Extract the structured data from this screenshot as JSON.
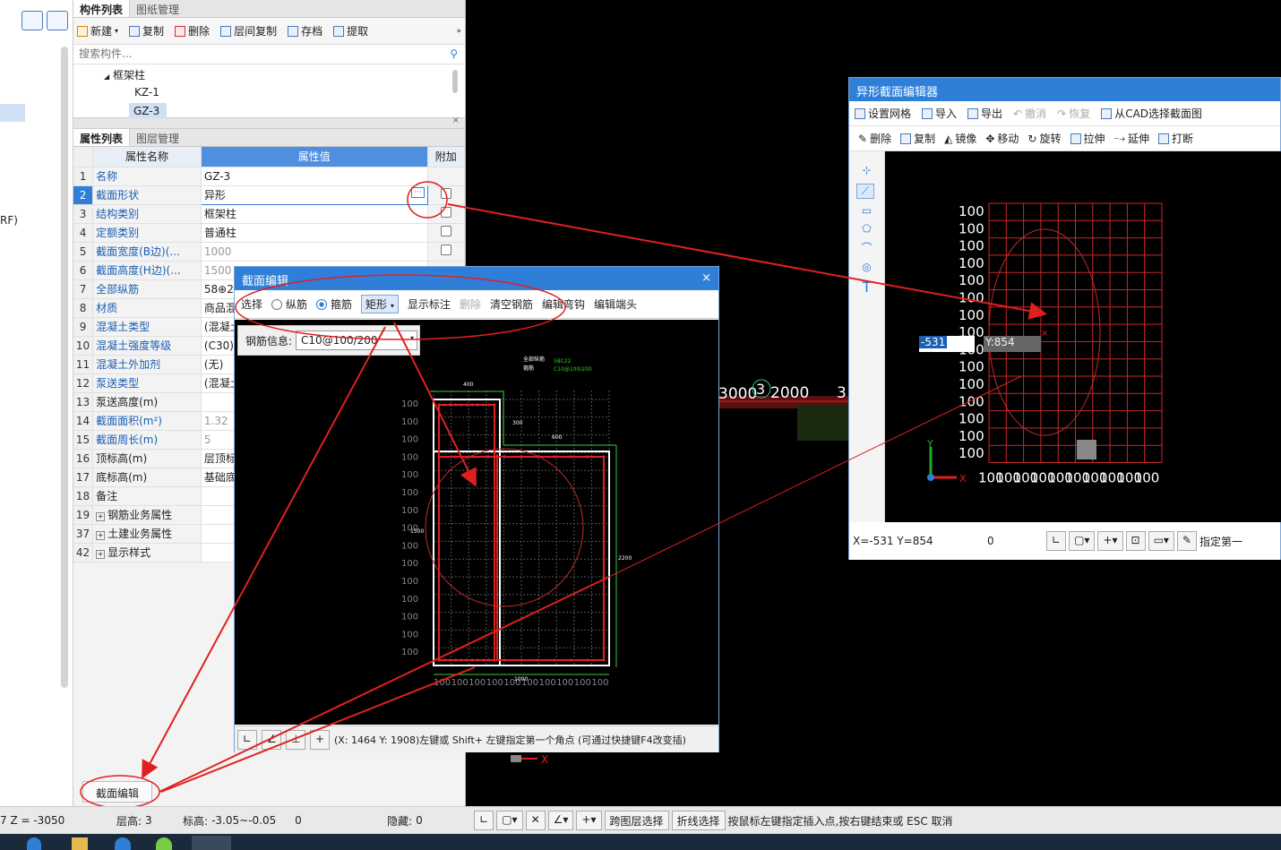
{
  "comp_panel": {
    "tab_active": "构件列表",
    "tab_other": "图纸管理",
    "toolbar": {
      "new": "新建",
      "copy": "复制",
      "delete": "删除",
      "floor_copy": "层间复制",
      "save": "存档",
      "extract": "提取"
    },
    "search_placeholder": "搜索构件...",
    "tree": {
      "group": "框架柱",
      "items": [
        "KZ-1",
        "GZ-3"
      ]
    }
  },
  "left_fragment": {
    "rf": "RF)"
  },
  "prop_panel": {
    "tab_active": "属性列表",
    "tab_other": "图层管理",
    "headers": {
      "name": "属性名称",
      "value": "属性值",
      "extra": "附加"
    },
    "rows": [
      {
        "n": "1",
        "name": "名称",
        "value": "GZ-3",
        "link": true,
        "gray": false,
        "check": false
      },
      {
        "n": "2",
        "name": "截面形状",
        "value": "异形",
        "link": true,
        "gray": false,
        "check": true
      },
      {
        "n": "3",
        "name": "结构类别",
        "value": "框架柱",
        "link": true,
        "gray": false,
        "check": true
      },
      {
        "n": "4",
        "name": "定额类别",
        "value": "普通柱",
        "link": true,
        "gray": false,
        "check": true
      },
      {
        "n": "5",
        "name": "截面宽度(B边)(...",
        "value": "1000",
        "link": true,
        "gray": true,
        "check": true
      },
      {
        "n": "6",
        "name": "截面高度(H边)(...",
        "value": "1500",
        "link": true,
        "gray": true,
        "check": false
      },
      {
        "n": "7",
        "name": "全部纵筋",
        "value": "58⊕22",
        "link": true,
        "gray": false,
        "check": false
      },
      {
        "n": "8",
        "name": "材质",
        "value": "商品混凝",
        "link": true,
        "gray": false,
        "check": false
      },
      {
        "n": "9",
        "name": "混凝土类型",
        "value": "(混凝土2",
        "link": true,
        "gray": false,
        "check": false
      },
      {
        "n": "10",
        "name": "混凝土强度等级",
        "value": "(C30)",
        "link": true,
        "gray": false,
        "check": false
      },
      {
        "n": "11",
        "name": "混凝土外加剂",
        "value": "(无)",
        "link": true,
        "gray": false,
        "check": false
      },
      {
        "n": "12",
        "name": "泵送类型",
        "value": "(混凝土泵",
        "link": true,
        "gray": false,
        "check": false
      },
      {
        "n": "13",
        "name": "泵送高度(m)",
        "value": "",
        "link": false,
        "gray": false,
        "check": false
      },
      {
        "n": "14",
        "name": "截面面积(m²)",
        "value": "1.32",
        "link": true,
        "gray": true,
        "check": false
      },
      {
        "n": "15",
        "name": "截面周长(m)",
        "value": "5",
        "link": true,
        "gray": true,
        "check": false
      },
      {
        "n": "16",
        "name": "顶标高(m)",
        "value": "层顶标高",
        "link": false,
        "gray": false,
        "check": false
      },
      {
        "n": "17",
        "name": "底标高(m)",
        "value": "基础底标",
        "link": false,
        "gray": false,
        "check": false
      },
      {
        "n": "18",
        "name": "备注",
        "value": "",
        "link": false,
        "gray": false,
        "check": false
      },
      {
        "n": "19",
        "name": "钢筋业务属性",
        "value": "",
        "link": false,
        "gray": false,
        "check": false
      },
      {
        "n": "37",
        "name": "土建业务属性",
        "value": "",
        "link": false,
        "gray": false,
        "check": false
      },
      {
        "n": "42",
        "name": "显示样式",
        "value": "",
        "link": false,
        "gray": false,
        "check": false
      }
    ],
    "bottom_button": "截面编辑"
  },
  "section_dialog": {
    "title": "截面编辑",
    "close": "×",
    "toolbar": {
      "select": "选择",
      "longitudinal": "纵筋",
      "stirrup": "箍筋",
      "shape": "矩形",
      "show_label": "显示标注",
      "delete": "删除",
      "clear": "清空钢筋",
      "edit_hook": "编辑弯钩",
      "edit_end": "编辑端头"
    },
    "rebar_info_label": "钢筋信息:",
    "rebar_info_value": "C10@100/200",
    "drawing": {
      "dim_400": "400",
      "dim_300": "300",
      "dim_600": "600",
      "dim_1500": "1500",
      "dim_2200": "2200",
      "dim_1000": "1000",
      "tag1": "全部纵筋",
      "tag2": "箍筋",
      "tag1_val": "58C22",
      "tag2_val": "C10@100/200",
      "grid": "100"
    },
    "status": "(X: 1464 Y: 1908)左键或 Shift+ 左键指定第一个角点 (可通过快捷键F4改变插)"
  },
  "cad_canvas": {
    "label": "3000",
    "label2": "3",
    "label3": "2000",
    "label4": "3"
  },
  "irregular_editor": {
    "title": "异形截面编辑器",
    "toolbar1": {
      "grid": "设置网格",
      "import": "导入",
      "export": "导出",
      "undo": "撤消",
      "redo": "恢复",
      "from_cad": "从CAD选择截面图"
    },
    "toolbar2": {
      "delete": "删除",
      "copy": "复制",
      "mirror": "镜像",
      "move": "移动",
      "rotate": "旋转",
      "stretch": "拉伸",
      "extend": "延伸",
      "break": "打断"
    },
    "grid_label": "100",
    "coord_x": "-531",
    "coord_y": "Y:854",
    "status": {
      "xy": "X=-531 Y=854",
      "zero": "0",
      "specify": "指定第一"
    }
  },
  "statusbar": {
    "z": "7 Z = -3050",
    "floor_h": "层高:",
    "floor_h_val": "3",
    "elev": "标高:",
    "elev_val": "-3.05~-0.05",
    "zero": "0",
    "hidden": "隐藏:",
    "hidden_val": "0",
    "cross_layer": "跨图层选择",
    "polyline": "折线选择",
    "hint": "按鼠标左键指定插入点,按右键结束或 ESC 取消"
  },
  "colors": {
    "accent": "#2f7fd8",
    "annotation": "#e02020",
    "grid": "#c82828"
  }
}
